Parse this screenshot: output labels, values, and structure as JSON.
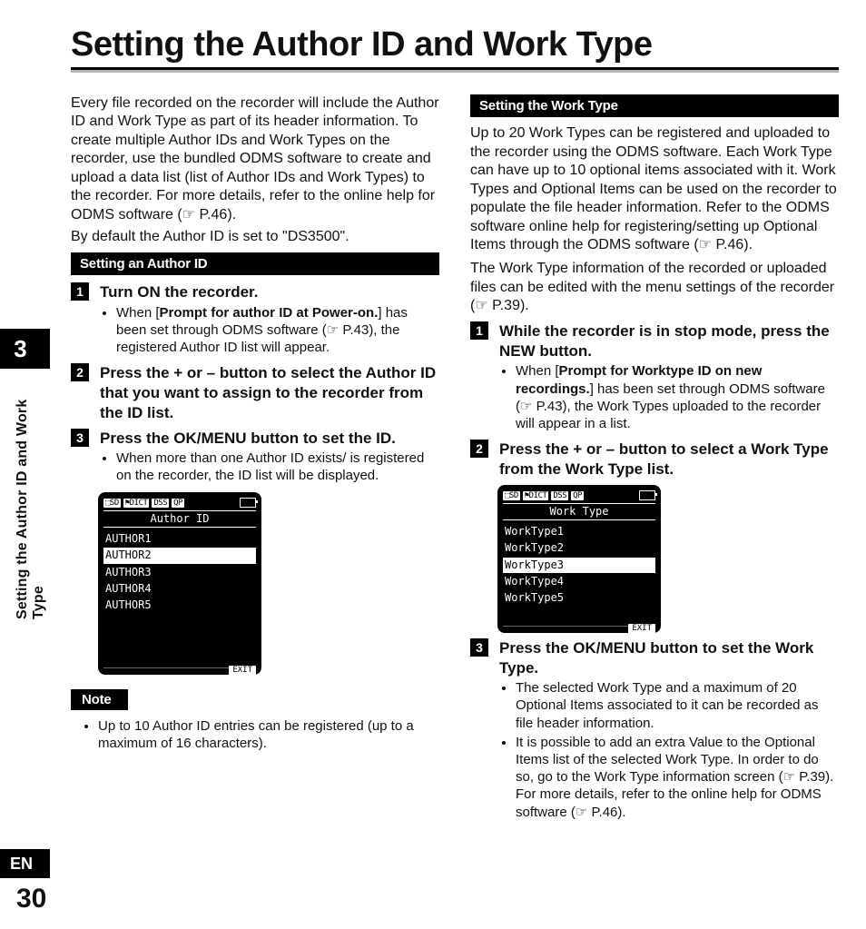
{
  "title": "Setting the Author ID and Work Type",
  "chapter_num": "3",
  "side_text": "Setting the Author ID and Work Type",
  "lang": "EN",
  "page_num": "30",
  "intro_1": "Every file recorded on the recorder will include the Author ID and Work Type as part of its header information. To create multiple Author IDs and Work Types on the recorder, use the bundled ODMS software to create and upload a data list (list of Author IDs and Work Types) to the recorder. For more details, refer to the online help for ODMS software (☞ P.46).",
  "intro_2": "By default the Author ID is set to \"DS3500\".",
  "bar_author": "Setting an Author ID",
  "a_step1": "Turn ON the recorder.",
  "a_step1_bullet_a": "When [",
  "a_step1_bullet_b": "Prompt for author ID at Power-on.",
  "a_step1_bullet_c": "] has been set through ODMS software (☞ P.43), the registered Author ID list will appear.",
  "a_step2": "Press the + or – button to select the Author ID that you want to assign to the recorder from the ID list.",
  "a_step3": "Press the OK/MENU button to set the ID.",
  "a_step3_bullet": "When more than one Author ID exists/ is registered on the recorder, the ID list will be displayed.",
  "lcd1": {
    "icons": [
      "⬚SD",
      "⚑DICT",
      "DSS",
      "QP"
    ],
    "title": "Author ID",
    "rows": [
      "AUTHOR1",
      "AUTHOR2",
      "AUTHOR3",
      "AUTHOR4",
      "AUTHOR5"
    ],
    "selected": 1,
    "exit": "EXIT"
  },
  "bar_note": "Note",
  "note_bullet": "Up to 10 Author ID entries can be registered (up to a maximum of 16 characters).",
  "bar_worktype": "Setting the Work Type",
  "w_intro1": "Up to 20 Work Types can be registered and uploaded to the recorder using the ODMS software. Each Work Type can have up to 10 optional items associated with it. Work Types and Optional Items can be used on the recorder to populate the file header information. Refer to the ODMS software online help for registering/setting up Optional Items through the ODMS software (☞ P.46).",
  "w_intro2": "The Work Type information of the recorded or uploaded files can be edited with the menu settings of the recorder (☞ P.39).",
  "w_step1": "While the recorder is in stop mode, press the NEW button.",
  "w_step1_bullet_a": "When [",
  "w_step1_bullet_b": "Prompt for Worktype ID on new recordings.",
  "w_step1_bullet_c": "] has been set through ODMS software (☞ P.43), the Work Types uploaded to the recorder will appear in a list.",
  "w_step2": "Press the + or – button to select a Work Type from the Work Type list.",
  "lcd2": {
    "icons": [
      "⬚SD",
      "⚑DICT",
      "DSS",
      "QP"
    ],
    "title": "Work Type",
    "rows": [
      "WorkType1",
      "WorkType2",
      "WorkType3",
      "WorkType4",
      "WorkType5"
    ],
    "selected": 2,
    "exit": "EXIT"
  },
  "w_step3": "Press the OK/MENU button to set the Work Type.",
  "w_step3_bullet1": "The selected Work Type and a maximum of 20 Optional Items associated to it can be recorded as file header information.",
  "w_step3_bullet2": "It is possible to add an extra Value to the Optional Items list of the selected Work Type. In order to do so, go to the Work Type information screen (☞ P.39). For more details, refer to the online help for ODMS software (☞ P.46)."
}
